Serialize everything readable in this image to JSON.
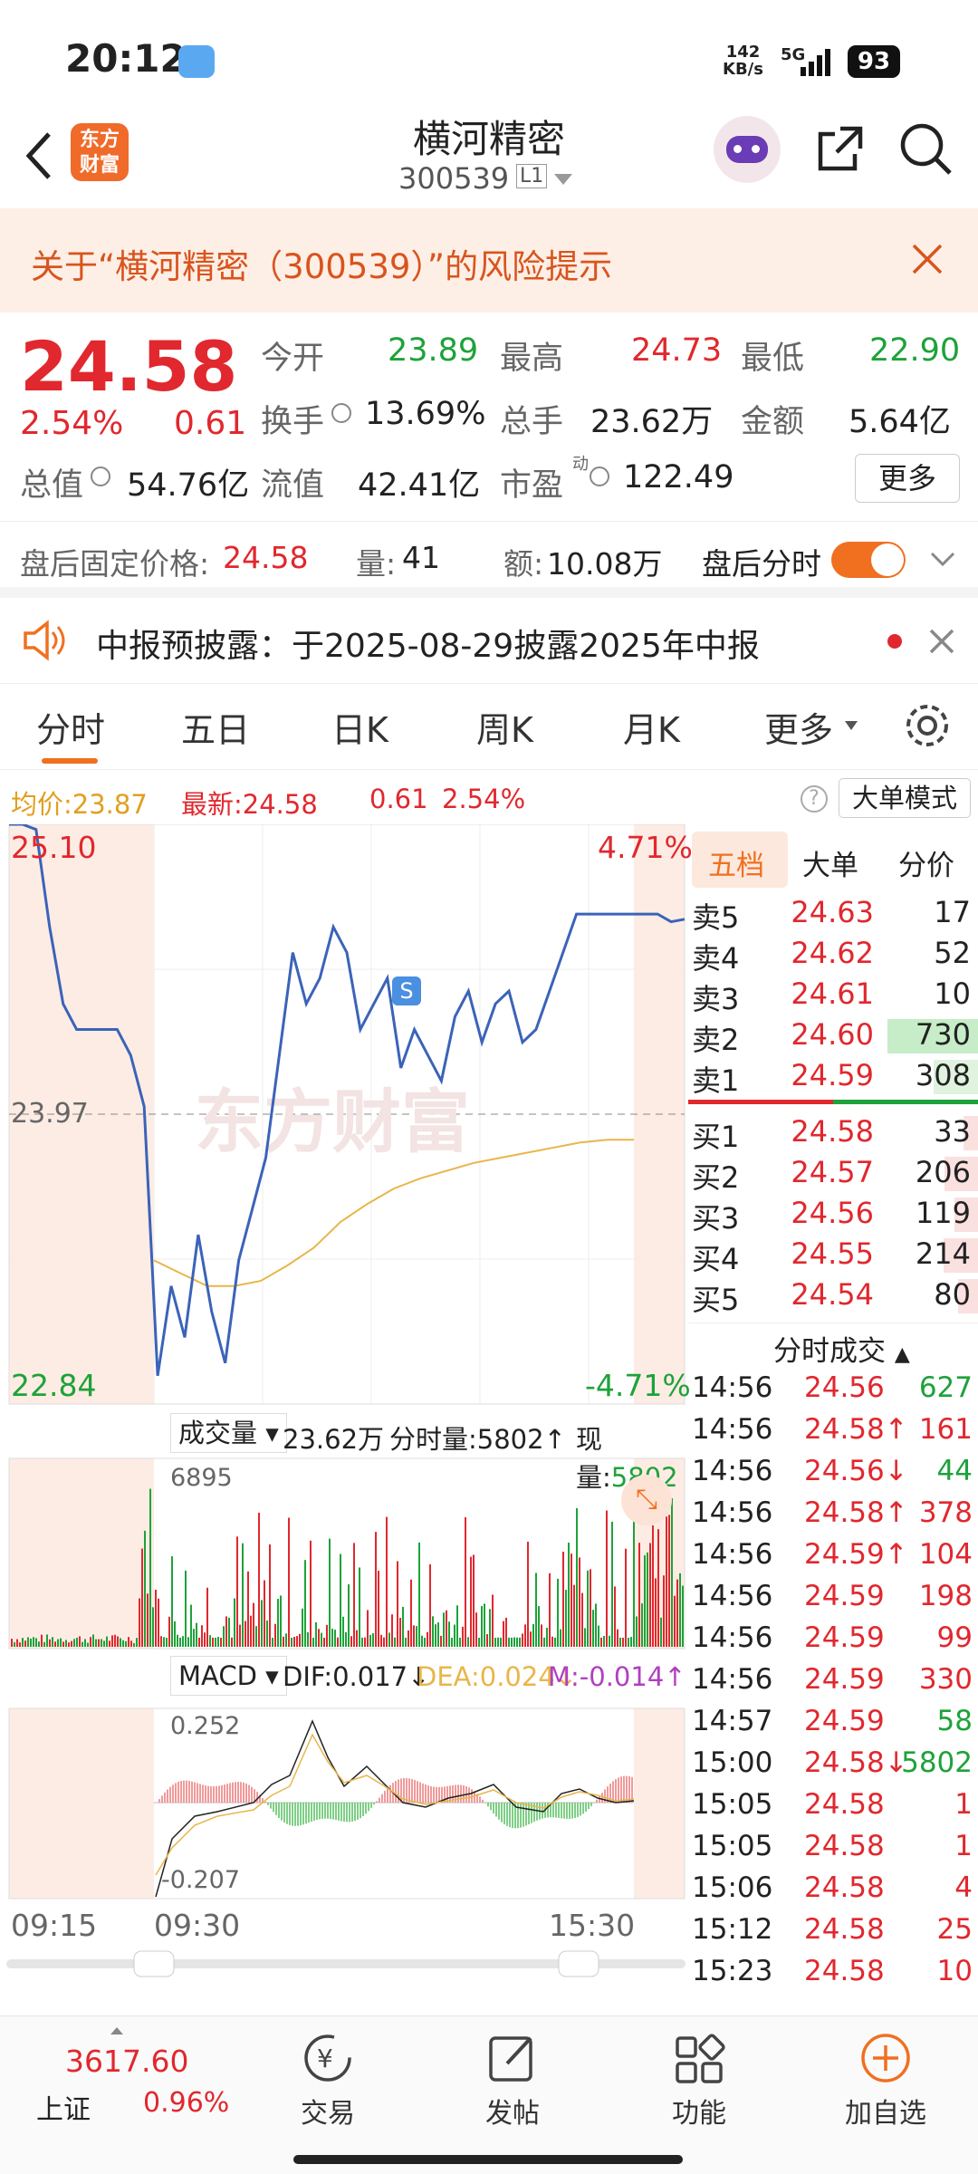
{
  "status_bar": {
    "time": "20:12",
    "net_speed": "142",
    "net_unit": "KB/s",
    "network": "5G",
    "battery": "93"
  },
  "header": {
    "back_label": "<",
    "logo_text_1": "东方",
    "logo_text_2": "财富",
    "stock_name": "横河精密",
    "stock_code": "300539",
    "board_tag": "L1"
  },
  "risk_banner": {
    "text": "关于“横河精密（300539）”的风险提示"
  },
  "quote": {
    "price": "24.58",
    "change_pct": "2.54%",
    "change": "0.61",
    "open_label": "今开",
    "open": "23.89",
    "high_label": "最高",
    "high": "24.73",
    "low_label": "最低",
    "low": "22.90",
    "turnover_label": "换手",
    "turnover": "13.69%",
    "volume_label": "总手",
    "volume": "23.62万",
    "amount_label": "金额",
    "amount": "5.64亿",
    "mktcap_label": "总值",
    "mktcap": "54.76亿",
    "float_label": "流值",
    "float_cap": "42.41亿",
    "pe_label": "市盈",
    "pe_sup": "动",
    "pe": "122.49",
    "more_label": "更多"
  },
  "after_hours": {
    "price_label": "盘后固定价格:",
    "price": "24.58",
    "vol_label": "量:",
    "vol": "41",
    "amt_label": "额:",
    "amt": "10.08万",
    "toggle_label": "盘后分时"
  },
  "notice": {
    "text": "中报预披露：于2025-08-29披露2025年中报"
  },
  "tabs": [
    "分时",
    "五日",
    "日K",
    "周K",
    "月K",
    "更多"
  ],
  "chart_info": {
    "avg_label": "均价:",
    "avg": "23.87",
    "latest_label": "最新:",
    "latest": "24.58",
    "change": "0.61",
    "change_pct": "2.54%",
    "mode_button": "大单模式"
  },
  "chart_labels": {
    "top_price": "25.10",
    "top_pct": "4.71%",
    "mid_price": "23.97",
    "bottom_price": "22.84",
    "bottom_pct": "-4.71%",
    "vol_selector": "成交量",
    "vol_total": "23.62万",
    "vol_period_label": "分时量:5802↑",
    "vol_now_label": "现量:",
    "vol_now": "5802",
    "vol_max": "6895",
    "macd_selector": "MACD",
    "dif": "DIF:0.017↓",
    "dea": "DEA:0.024↓",
    "m": "M:-0.014↑",
    "macd_max": "0.252",
    "macd_min": "-0.207",
    "time_start": "09:15",
    "time_open": "09:30",
    "time_close": "15:30",
    "s_marker": "S"
  },
  "chart_data": {
    "type": "line",
    "x_range": [
      "09:15",
      "15:30"
    ],
    "ylim": [
      22.84,
      25.1
    ],
    "ref_price": 23.97,
    "series": [
      {
        "name": "最新",
        "values": [
          25.1,
          25.1,
          25.08,
          24.7,
          24.4,
          24.3,
          24.3,
          24.3,
          24.3,
          24.2,
          24.0,
          22.95,
          23.3,
          23.1,
          23.5,
          23.2,
          23.0,
          23.4,
          23.6,
          23.8,
          24.2,
          24.6,
          24.4,
          24.5,
          24.7,
          24.6,
          24.3,
          24.4,
          24.5,
          24.15,
          24.3,
          24.2,
          24.1,
          24.35,
          24.45,
          24.25,
          24.4,
          24.45,
          24.25,
          24.3,
          24.45,
          24.6,
          24.75,
          24.75,
          24.75,
          24.75,
          24.75,
          24.75,
          24.75,
          24.72,
          24.73
        ]
      },
      {
        "name": "均价",
        "values": [
          23.4,
          23.35,
          23.3,
          23.3,
          23.32,
          23.38,
          23.45,
          23.55,
          23.62,
          23.68,
          23.72,
          23.75,
          23.78,
          23.8,
          23.82,
          23.84,
          23.86,
          23.87,
          23.87
        ]
      }
    ]
  },
  "order_book": {
    "tabs": [
      "五档",
      "大单",
      "分价"
    ],
    "asks": [
      {
        "label": "卖5",
        "price": "24.63",
        "vol": "17"
      },
      {
        "label": "卖4",
        "price": "24.62",
        "vol": "52"
      },
      {
        "label": "卖3",
        "price": "24.61",
        "vol": "10"
      },
      {
        "label": "卖2",
        "price": "24.60",
        "vol": "730"
      },
      {
        "label": "卖1",
        "price": "24.59",
        "vol": "308"
      }
    ],
    "bids": [
      {
        "label": "买1",
        "price": "24.58",
        "vol": "33"
      },
      {
        "label": "买2",
        "price": "24.57",
        "vol": "206"
      },
      {
        "label": "买3",
        "price": "24.56",
        "vol": "119"
      },
      {
        "label": "买4",
        "price": "24.55",
        "vol": "214"
      },
      {
        "label": "买5",
        "price": "24.54",
        "vol": "80"
      }
    ],
    "trades_title": "分时成交",
    "trades": [
      {
        "time": "14:56",
        "price": "24.56",
        "vol": "627",
        "color": "green"
      },
      {
        "time": "14:56",
        "price": "24.58↑",
        "vol": "161",
        "color": "red"
      },
      {
        "time": "14:56",
        "price": "24.56↓",
        "vol": "44",
        "color": "green"
      },
      {
        "time": "14:56",
        "price": "24.58↑",
        "vol": "378",
        "color": "red"
      },
      {
        "time": "14:56",
        "price": "24.59↑",
        "vol": "104",
        "color": "red"
      },
      {
        "time": "14:56",
        "price": "24.59",
        "vol": "198",
        "color": "red"
      },
      {
        "time": "14:56",
        "price": "24.59",
        "vol": "99",
        "color": "red"
      },
      {
        "time": "14:56",
        "price": "24.59",
        "vol": "330",
        "color": "red"
      },
      {
        "time": "14:57",
        "price": "24.59",
        "vol": "58",
        "color": "green"
      },
      {
        "time": "15:00",
        "price": "24.58↓",
        "vol": "5802",
        "color": "green"
      },
      {
        "time": "15:05",
        "price": "24.58",
        "vol": "1",
        "color": "red"
      },
      {
        "time": "15:05",
        "price": "24.58",
        "vol": "1",
        "color": "red"
      },
      {
        "time": "15:06",
        "price": "24.58",
        "vol": "4",
        "color": "red"
      },
      {
        "time": "15:12",
        "price": "24.58",
        "vol": "25",
        "color": "red"
      },
      {
        "time": "15:23",
        "price": "24.58",
        "vol": "10",
        "color": "red"
      }
    ]
  },
  "bottom_nav": {
    "index_value": "3617.60",
    "index_name": "上证",
    "index_change": "0.96%",
    "trade": "交易",
    "post": "发帖",
    "func": "功能",
    "add_watch": "加自选"
  },
  "colors": {
    "up": "#e0282e",
    "down": "#1ea23a",
    "accent": "#f07020",
    "line": "#3b63b8",
    "avg": "#e8b64a"
  }
}
